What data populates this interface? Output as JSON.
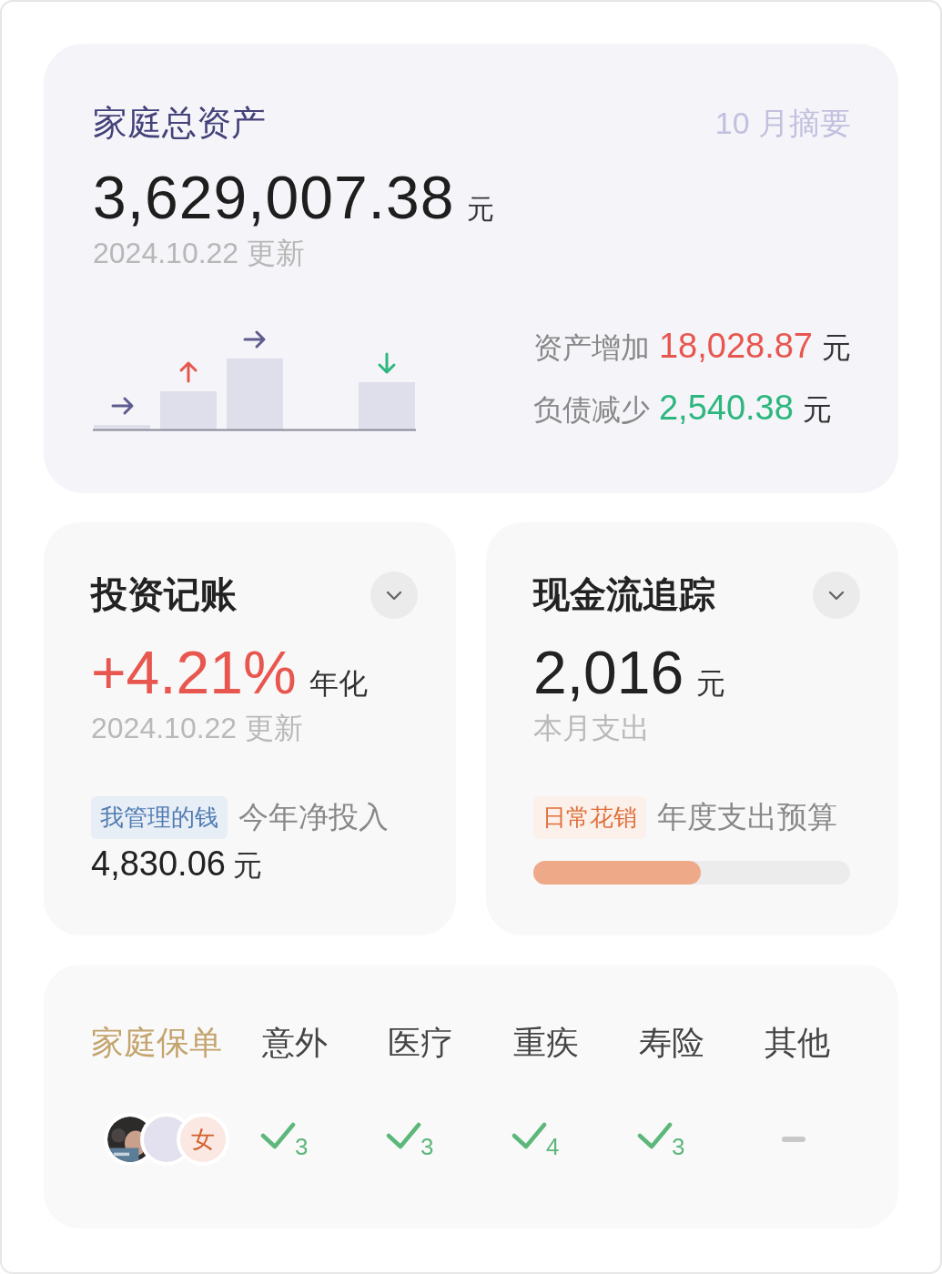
{
  "summary": {
    "title": "家庭总资产",
    "period": "10 月摘要",
    "amount": "3,629,007.38",
    "unit": "元",
    "updated": "2024.10.22 更新",
    "stats": [
      {
        "label": "资产增加",
        "value": "18,028.87",
        "unit": "元",
        "color": "#e8574f"
      },
      {
        "label": "负债减少",
        "value": "2,540.38",
        "unit": "元",
        "color": "#2db77f"
      }
    ]
  },
  "investment": {
    "title": "投资记账",
    "expanded": false,
    "rate": "+4.21%",
    "rate_label": "年化",
    "updated": "2024.10.22 更新",
    "tag": "我管理的钱",
    "note": "今年净投入",
    "amount": "4,830.06",
    "unit": "元"
  },
  "cashflow": {
    "title": "现金流追踪",
    "expanded": false,
    "amount": "2,016",
    "unit": "元",
    "caption": "本月支出",
    "tag": "日常花销",
    "note": "年度支出预算",
    "budget": {
      "level": 0.53
    }
  },
  "policies": {
    "title": "家庭保单",
    "members": [
      {
        "kind": "picture"
      },
      {
        "kind": "avatar"
      },
      {
        "kind": "avatar",
        "label": "女"
      }
    ],
    "columns": [
      {
        "label": "意外",
        "kind": "check",
        "count": "3"
      },
      {
        "label": "医疗",
        "kind": "check",
        "count": "3"
      },
      {
        "label": "重疾",
        "kind": "check",
        "count": "4"
      },
      {
        "label": "寿险",
        "kind": "check",
        "count": "3"
      },
      {
        "label": "其他",
        "kind": "none"
      }
    ]
  }
}
